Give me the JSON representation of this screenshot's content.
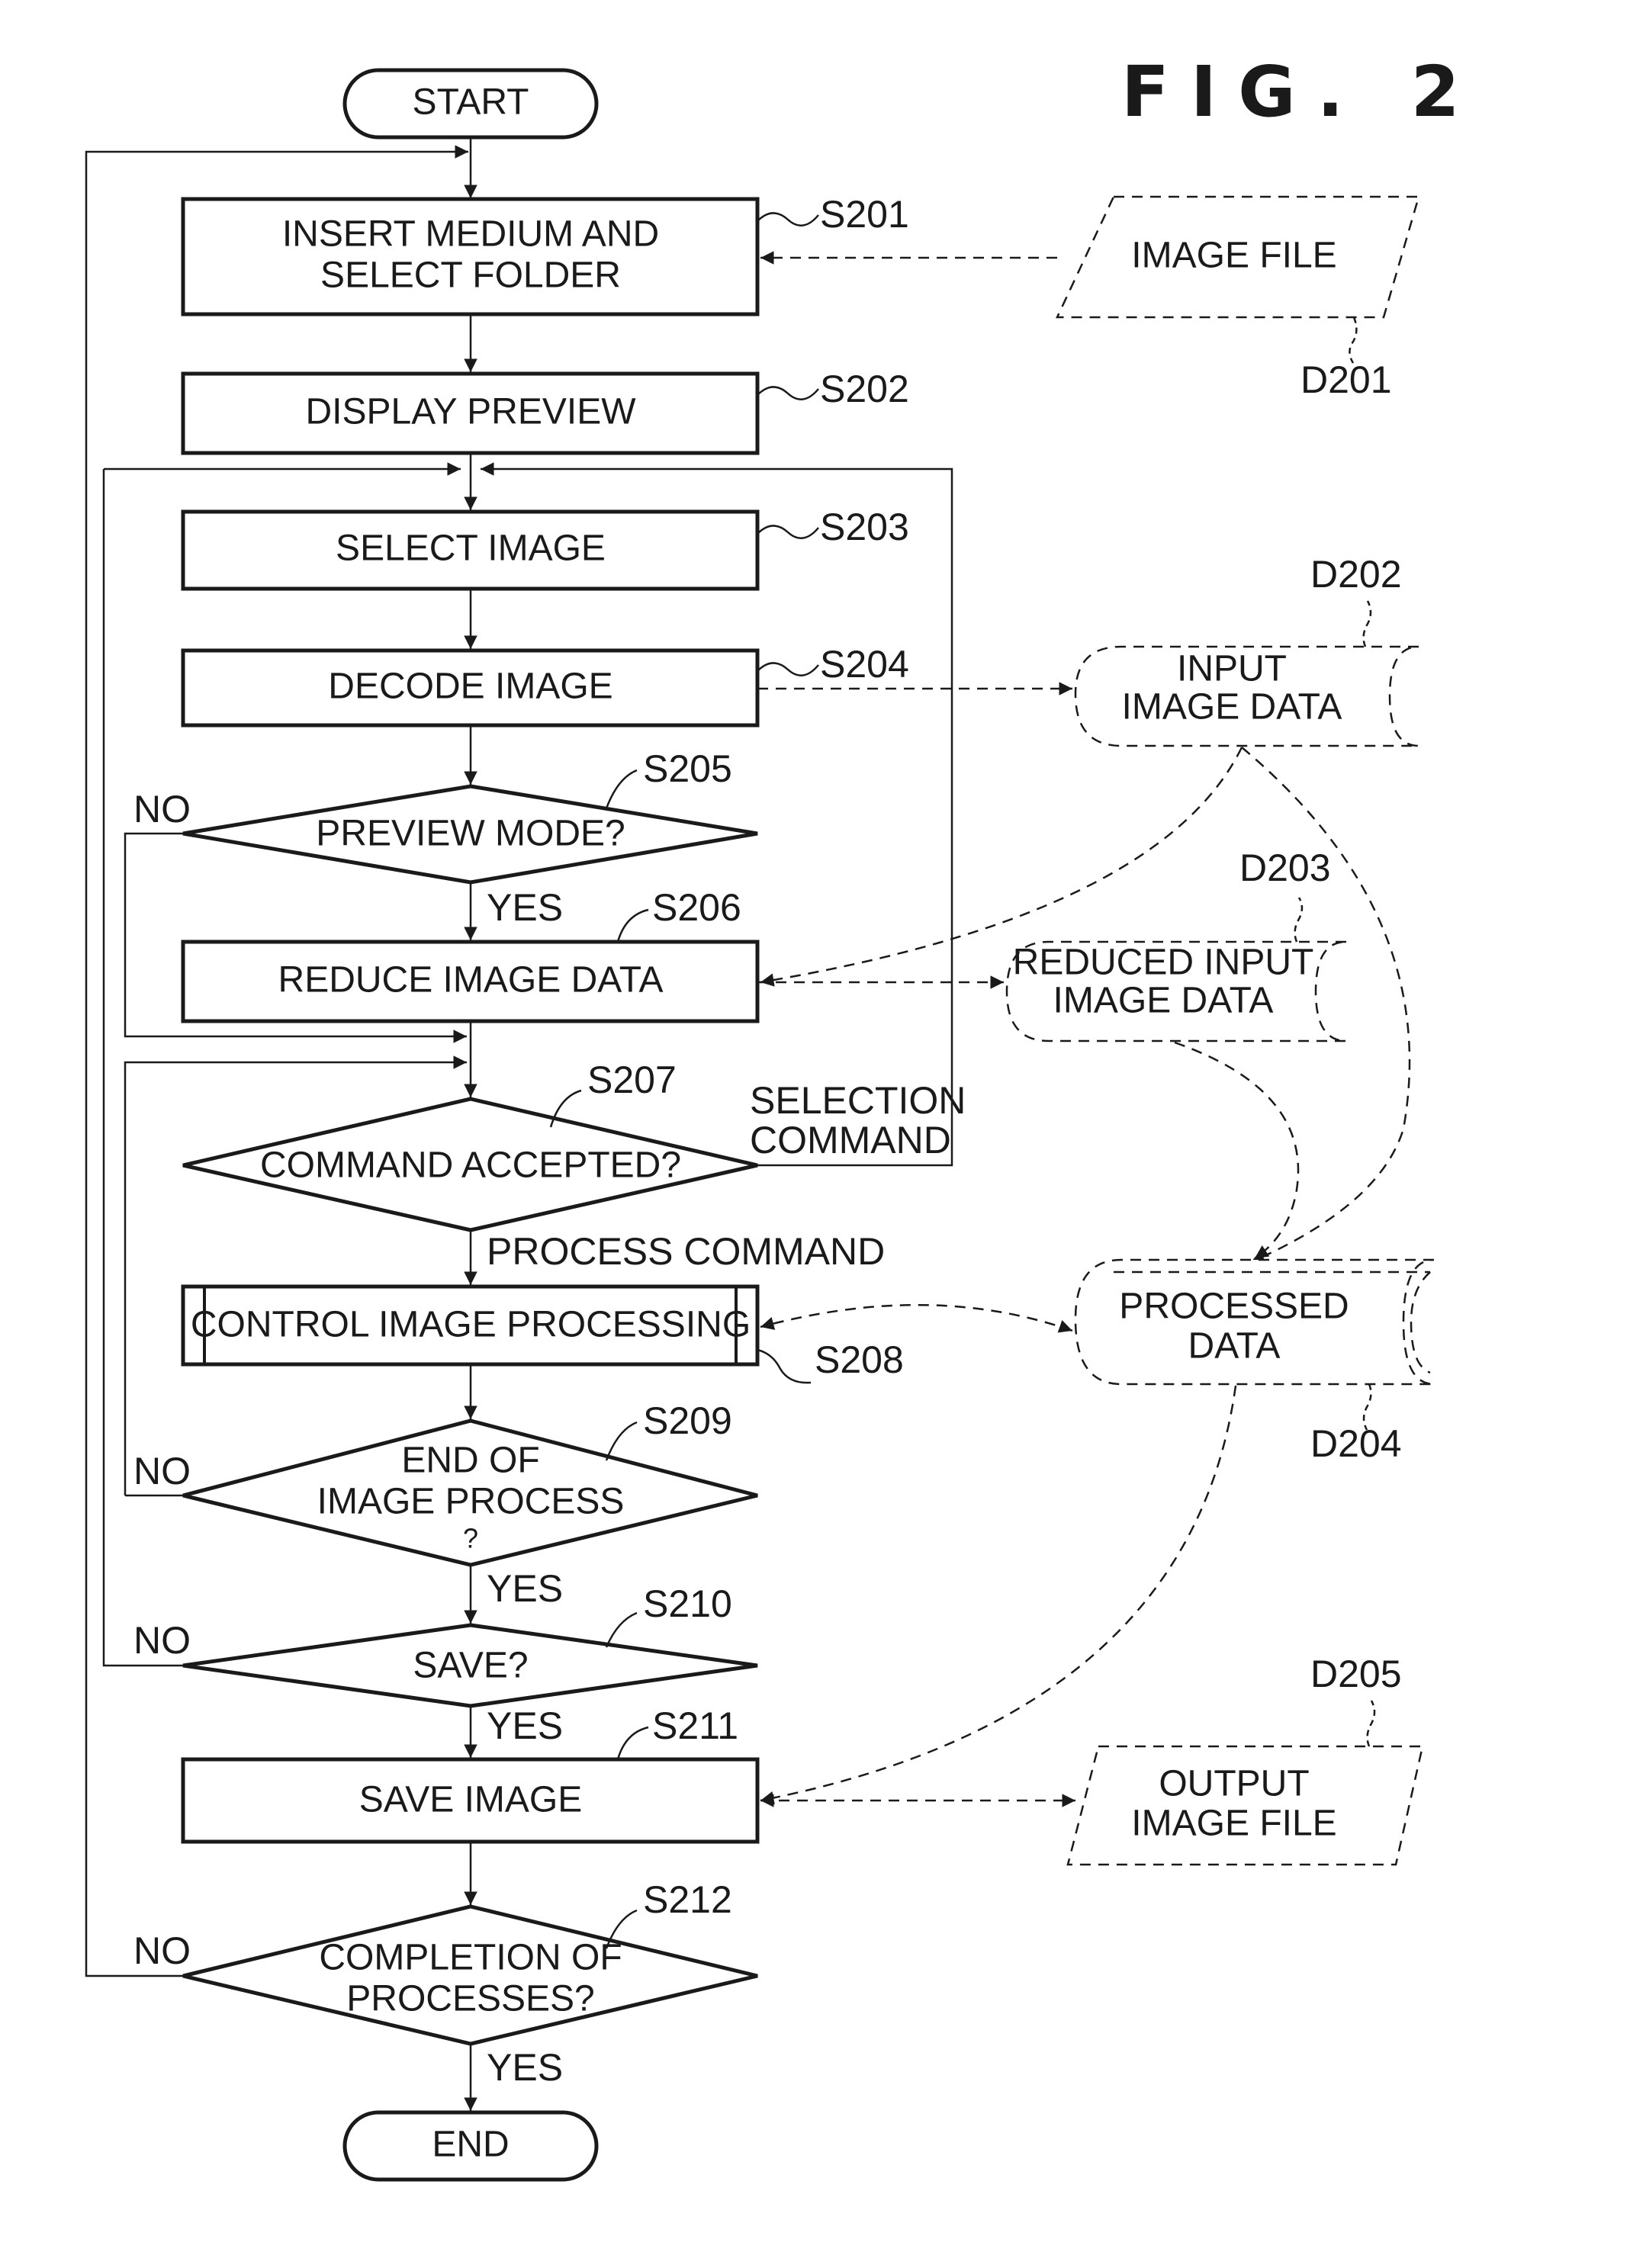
{
  "figure_title": "FIG. 2",
  "terminals": {
    "start": "START",
    "end": "END"
  },
  "steps": {
    "s201": {
      "ref": "S201",
      "line1": "INSERT MEDIUM AND",
      "line2": "SELECT FOLDER"
    },
    "s202": {
      "ref": "S202",
      "text": "DISPLAY PREVIEW"
    },
    "s203": {
      "ref": "S203",
      "text": "SELECT IMAGE"
    },
    "s204": {
      "ref": "S204",
      "text": "DECODE IMAGE"
    },
    "s205": {
      "ref": "S205",
      "text": "PREVIEW MODE?"
    },
    "s206": {
      "ref": "S206",
      "text": "REDUCE IMAGE DATA"
    },
    "s207": {
      "ref": "S207",
      "text": "COMMAND ACCEPTED?"
    },
    "s208": {
      "ref": "S208",
      "text": "CONTROL IMAGE PROCESSING"
    },
    "s209": {
      "ref": "S209",
      "line1": "END OF",
      "line2": "IMAGE PROCESS",
      "line3": "?"
    },
    "s210": {
      "ref": "S210",
      "text": "SAVE?"
    },
    "s211": {
      "ref": "S211",
      "text": "SAVE IMAGE"
    },
    "s212": {
      "ref": "S212",
      "line1": "COMPLETION OF",
      "line2": "PROCESSES?"
    }
  },
  "branch_labels": {
    "yes": "YES",
    "no": "NO",
    "selection_command_1": "SELECTION",
    "selection_command_2": "COMMAND",
    "process_command": "PROCESS COMMAND"
  },
  "data_items": {
    "d201": {
      "ref": "D201",
      "line1": "IMAGE FILE"
    },
    "d202": {
      "ref": "D202",
      "line1": "INPUT",
      "line2": "IMAGE DATA"
    },
    "d203": {
      "ref": "D203",
      "line1": "REDUCED INPUT",
      "line2": "IMAGE DATA"
    },
    "d204": {
      "ref": "D204",
      "line1": "PROCESSED",
      "line2": "DATA"
    },
    "d205": {
      "ref": "D205",
      "line1": "OUTPUT",
      "line2": "IMAGE FILE"
    }
  }
}
